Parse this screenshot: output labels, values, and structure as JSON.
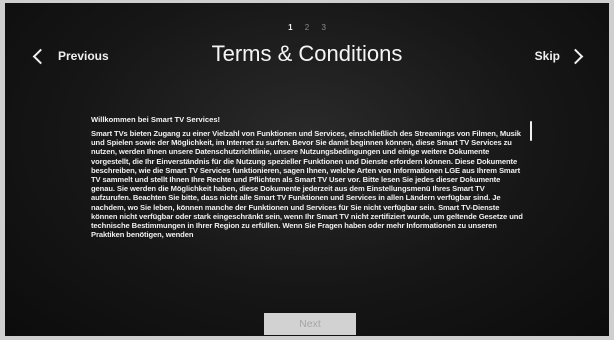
{
  "pager": {
    "pages": [
      "1",
      "2",
      "3"
    ],
    "current": "1"
  },
  "header": {
    "previous_label": "Previous",
    "title": "Terms & Conditions",
    "skip_label": "Skip"
  },
  "document": {
    "heading": "Willkommen bei Smart TV Services!",
    "body": "Smart TVs bieten Zugang zu einer Vielzahl von Funktionen und Services, einschließlich des Streamings von Filmen, Musik und Spielen sowie der Möglichkeit, im Internet zu surfen. Bevor Sie damit beginnen können, diese Smart TV Services zu nutzen, werden Ihnen unsere Datenschutzrichtlinie, unsere Nutzungsbedingungen und einige weitere Dokumente vorgestellt, die Ihr Einverständnis für die Nutzung spezieller Funktionen und Dienste erfordern können. Diese Dokumente beschreiben, wie die Smart TV Services funktionieren, sagen Ihnen, welche Arten von Informationen LGE aus Ihrem Smart TV sammelt und stellt Ihnen Ihre Rechte und Pflichten als Smart TV User vor. Bitte lesen Sie jedes dieser Dokumente genau. Sie werden die Möglichkeit haben, diese Dokumente jederzeit aus dem Einstellungsmenü Ihres Smart TV aufzurufen. Beachten Sie bitte, dass nicht alle Smart TV Funktionen und Services in allen Ländern verfügbar sind. Je nachdem, wo Sie leben, können manche der Funktionen und Services für Sie nicht verfügbar sein. Smart TV-Dienste können nicht verfügbar oder stark eingeschränkt sein, wenn Ihr Smart TV nicht zertifiziert wurde, um geltende Gesetze und technische Bestimmungen in Ihrer Region zu erfüllen. Wenn Sie Fragen haben oder mehr Informationen zu unseren Praktiken benötigen, wenden"
  },
  "footer": {
    "next_label": "Next"
  }
}
